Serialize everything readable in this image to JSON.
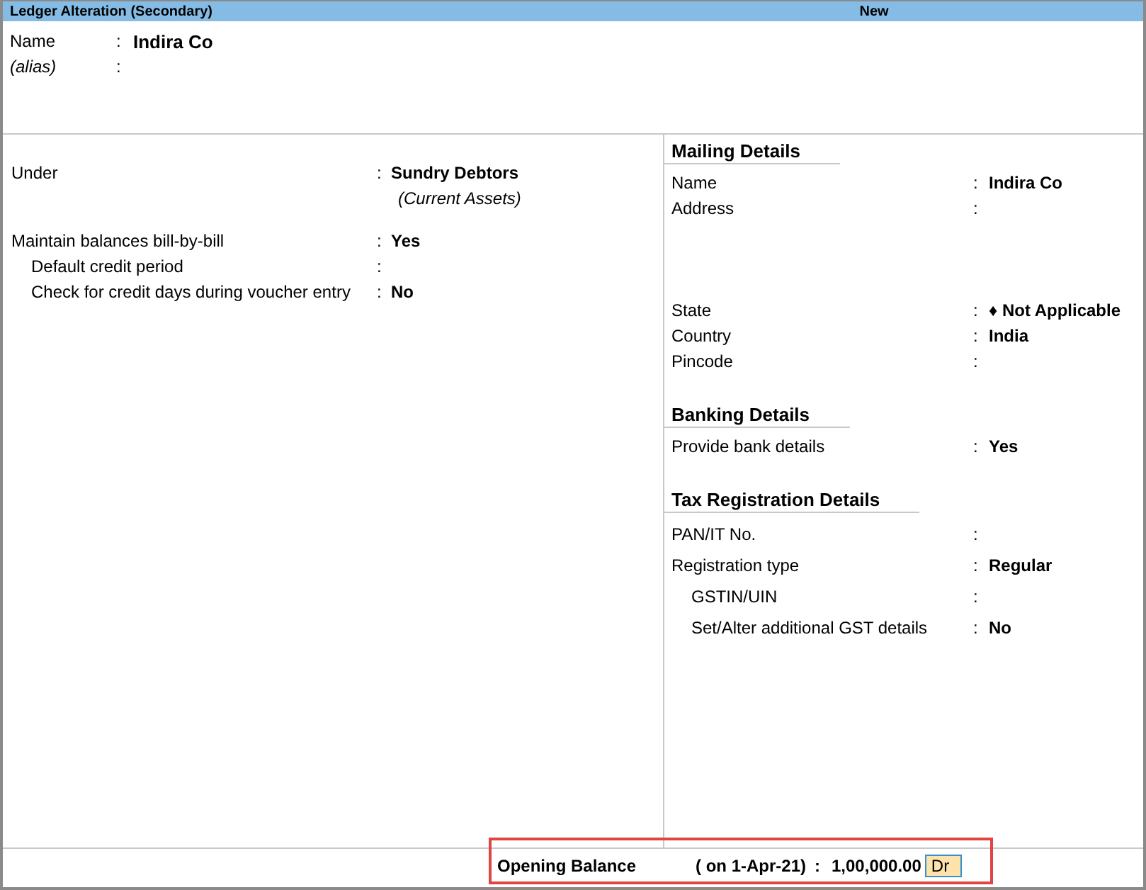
{
  "title_bar": {
    "title": "Ledger Alteration (Secondary)",
    "mode": "New"
  },
  "identity": [
    {
      "kind": "name",
      "label": "Name",
      "colon": ":",
      "value": "Indira Co"
    },
    {
      "kind": "alias",
      "label": "(alias)",
      "colon": ":"
    }
  ],
  "general": [
    {
      "label": "Under",
      "colon": ":",
      "value": "Sundry Debtors",
      "note": "(Current Assets)"
    },
    {
      "label": "Maintain balances bill-by-bill",
      "colon": ":",
      "value": "Yes",
      "children": [
        {
          "label": "Default credit period",
          "colon": ":"
        },
        {
          "label": "Check for credit days during voucher entry",
          "colon": ":",
          "value": "No"
        }
      ]
    }
  ],
  "sections": [
    {
      "heading": "Mailing Details",
      "fields": [
        {
          "kind": "line",
          "label": "Name",
          "colon": ":",
          "value": "Indira Co"
        },
        {
          "kind": "address",
          "label": "Address",
          "colon": ":"
        },
        {
          "kind": "line",
          "label": "State",
          "colon": ":",
          "value": "♦ Not Applicable"
        },
        {
          "kind": "line",
          "label": "Country",
          "colon": ":",
          "value": "India"
        },
        {
          "kind": "line",
          "label": "Pincode",
          "colon": ":"
        }
      ]
    },
    {
      "heading": "Banking Details",
      "fields": [
        {
          "kind": "line",
          "label": "Provide bank details",
          "colon": ":",
          "value": "Yes"
        }
      ]
    },
    {
      "heading": "Tax Registration Details",
      "fields": [
        {
          "kind": "line",
          "label": "PAN/IT No.",
          "colon": ":"
        },
        {
          "kind": "line",
          "label": "Registration type",
          "colon": ":",
          "value": "Regular",
          "children": [
            {
              "kind": "line",
              "label": "GSTIN/UIN",
              "colon": ":"
            },
            {
              "kind": "line",
              "label": "Set/Alter additional GST details",
              "colon": ":",
              "value": "No"
            }
          ]
        }
      ]
    }
  ],
  "opening_balance": {
    "label": "Opening Balance",
    "date": "( on 1-Apr-21)",
    "colon": ":",
    "amount": "1,00,000.00",
    "dr_cr": "Dr"
  }
}
